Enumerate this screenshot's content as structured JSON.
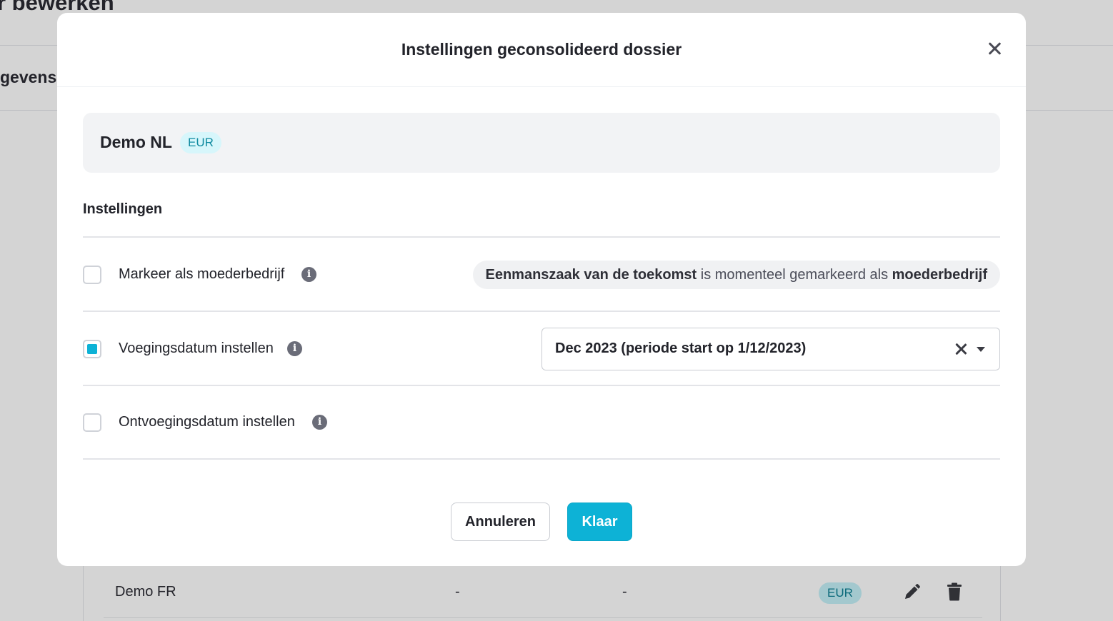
{
  "background": {
    "page_title_fragment": "r bewerken",
    "tab_fragment": "gevens",
    "row": {
      "name": "Demo FR",
      "col_a": "-",
      "col_b": "-",
      "currency": "EUR"
    }
  },
  "modal": {
    "title": "Instellingen geconsolideerd dossier",
    "company": {
      "name": "Demo NL",
      "currency": "EUR"
    },
    "section_title": "Instellingen",
    "settings": [
      {
        "label": "Markeer als moederbedrijf",
        "checked": false,
        "notice": {
          "entity": "Eenmanszaak van de toekomst",
          "middle": " is momenteel gemarkeerd als ",
          "role": "moederbedrijf"
        }
      },
      {
        "label": "Voegingsdatum instellen",
        "checked": true,
        "selected_value": "Dec 2023 (periode start op 1/12/2023)"
      },
      {
        "label": "Ontvoegingsdatum instellen",
        "checked": false
      }
    ],
    "buttons": {
      "cancel": "Annuleren",
      "confirm": "Klaar"
    }
  },
  "colors": {
    "accent": "#0db2d6",
    "badge_bg": "#d7f6fb",
    "badge_text": "#0f8aa0"
  }
}
